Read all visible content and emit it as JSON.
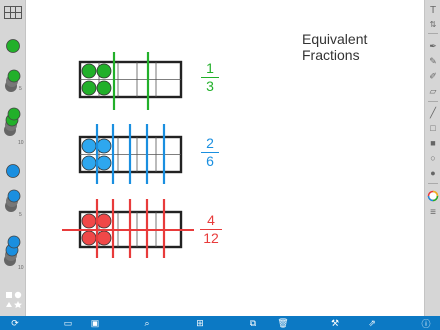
{
  "title": "Equivalent\nFractions",
  "colors": {
    "green": "#22b02a",
    "blue": "#1a8fe0",
    "red": "#e83b3b",
    "toolbar_blue": "#0c79c4"
  },
  "fractions": [
    {
      "numerator": "1",
      "denominator": "3",
      "color": "#22b02a"
    },
    {
      "numerator": "2",
      "denominator": "6",
      "color": "#1a8fe0"
    },
    {
      "numerator": "4",
      "denominator": "12",
      "color": "#e83b3b"
    }
  ],
  "tray": {
    "counter_stacks": [
      {
        "color": "green",
        "count": "5"
      },
      {
        "color": "green",
        "count": "10"
      },
      {
        "color": "blue",
        "count": "5"
      },
      {
        "color": "blue",
        "count": "10"
      }
    ]
  },
  "right_toolbar": [
    "text-icon",
    "adjust-icon",
    "pen-icon",
    "pencil-icon",
    "marker-icon",
    "eraser-icon",
    "line-icon",
    "square-outline-icon",
    "square-filled-icon",
    "circle-outline-icon",
    "circle-filled-icon",
    "color-picker-icon",
    "menu-icon"
  ],
  "bottom_toolbar": [
    "refresh-icon",
    "frame-icon",
    "image-icon",
    "zoom-icon",
    "layout-icon",
    "duplicate-icon",
    "trash-icon",
    "wrench-icon",
    "share-icon",
    "info-icon"
  ]
}
